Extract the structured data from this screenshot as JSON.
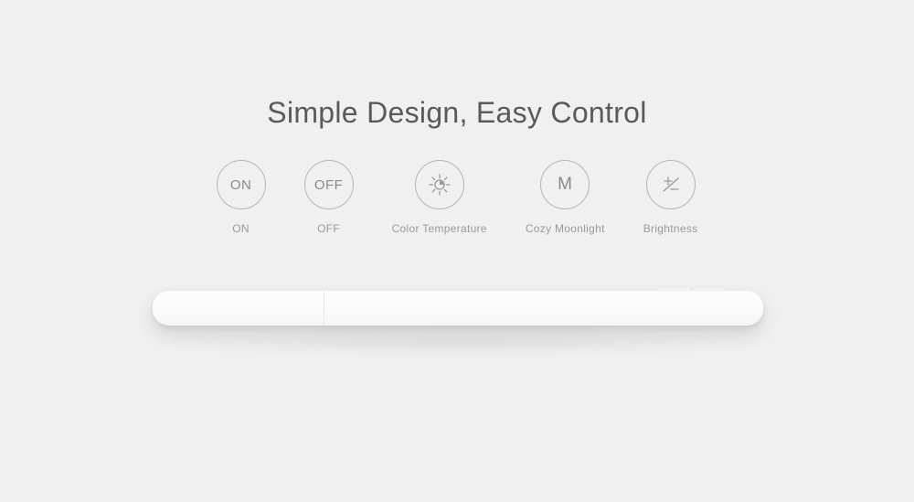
{
  "title": "Simple Design, Easy Control",
  "icons": {
    "on": {
      "symbol": "ON",
      "label": "ON"
    },
    "off": {
      "symbol": "OFF",
      "label": "OFF"
    },
    "color_temp": {
      "label": "Color Temperature"
    },
    "moonlight": {
      "symbol": "M",
      "label": "Cozy Moonlight"
    },
    "brightness": {
      "label": "Brightness"
    }
  }
}
